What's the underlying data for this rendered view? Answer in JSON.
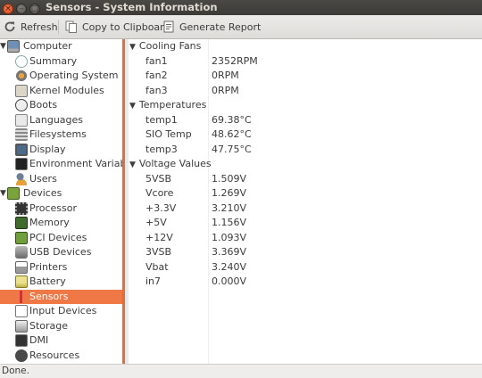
{
  "window": {
    "title": "Sensors - System Information"
  },
  "toolbar": {
    "refresh": "Refresh",
    "copy": "Copy to Clipboard",
    "report": "Generate Report"
  },
  "tree": {
    "computer": {
      "label": "Computer",
      "items": [
        {
          "label": "Summary",
          "icon": "summary-icon"
        },
        {
          "label": "Operating System",
          "icon": "os-icon"
        },
        {
          "label": "Kernel Modules",
          "icon": "kernel-modules-icon"
        },
        {
          "label": "Boots",
          "icon": "boots-icon"
        },
        {
          "label": "Languages",
          "icon": "languages-icon"
        },
        {
          "label": "Filesystems",
          "icon": "filesystems-icon"
        },
        {
          "label": "Display",
          "icon": "display-icon"
        },
        {
          "label": "Environment Variables",
          "icon": "env-vars-icon"
        },
        {
          "label": "Users",
          "icon": "users-icon"
        }
      ]
    },
    "devices": {
      "label": "Devices",
      "items": [
        {
          "label": "Processor",
          "icon": "processor-icon"
        },
        {
          "label": "Memory",
          "icon": "memory-icon"
        },
        {
          "label": "PCI Devices",
          "icon": "pci-icon"
        },
        {
          "label": "USB Devices",
          "icon": "usb-icon"
        },
        {
          "label": "Printers",
          "icon": "printer-icon"
        },
        {
          "label": "Battery",
          "icon": "battery-icon"
        },
        {
          "label": "Sensors",
          "icon": "sensors-icon",
          "selected": true
        },
        {
          "label": "Input Devices",
          "icon": "input-devices-icon"
        },
        {
          "label": "Storage",
          "icon": "storage-icon"
        },
        {
          "label": "DMI",
          "icon": "dmi-icon"
        },
        {
          "label": "Resources",
          "icon": "resources-icon"
        }
      ]
    }
  },
  "sensors": {
    "groups": [
      {
        "label": "Cooling Fans",
        "rows": [
          {
            "name": "fan1",
            "value": "2352RPM"
          },
          {
            "name": "fan2",
            "value": "0RPM"
          },
          {
            "name": "fan3",
            "value": "0RPM"
          }
        ]
      },
      {
        "label": "Temperatures",
        "rows": [
          {
            "name": "temp1",
            "value": "69.38°C"
          },
          {
            "name": "SIO Temp",
            "value": "48.62°C"
          },
          {
            "name": "temp3",
            "value": "47.75°C"
          }
        ]
      },
      {
        "label": "Voltage Values",
        "rows": [
          {
            "name": "5VSB",
            "value": "1.509V"
          },
          {
            "name": "Vcore",
            "value": "1.269V"
          },
          {
            "name": "+3.3V",
            "value": "3.210V"
          },
          {
            "name": "+5V",
            "value": "1.156V"
          },
          {
            "name": "+12V",
            "value": "1.093V"
          },
          {
            "name": "3VSB",
            "value": "3.369V"
          },
          {
            "name": "Vbat",
            "value": "3.240V"
          },
          {
            "name": "in7",
            "value": "0.000V"
          }
        ]
      }
    ]
  },
  "status": {
    "text": "Done."
  },
  "colors": {
    "accent": "#f07746",
    "titlebar": "#3c3b37"
  }
}
